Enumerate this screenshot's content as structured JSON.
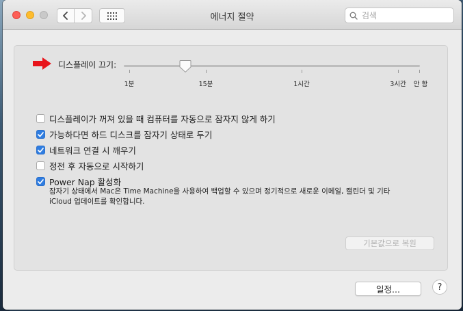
{
  "window": {
    "title": "에너지 절약"
  },
  "search": {
    "placeholder": "검색"
  },
  "slider": {
    "label": "디스플레이 끄기:",
    "value": "15분",
    "ticks": [
      "1분",
      "15분",
      "1시간",
      "3시간",
      "안 함"
    ]
  },
  "options": [
    {
      "label": "디스플레이가 꺼져 있을 때 컴퓨터를 자동으로 잠자지 않게 하기",
      "checked": false
    },
    {
      "label": "가능하다면 하드 디스크를 잠자기 상태로 두기",
      "checked": true
    },
    {
      "label": "네트워크 연결 시 깨우기",
      "checked": true
    },
    {
      "label": "정전 후 자동으로 시작하기",
      "checked": false
    },
    {
      "label": "Power Nap 활성화",
      "checked": true
    }
  ],
  "power_nap": {
    "description_line1": "잠자기 상태에서 Mac은 Time Machine을 사용하여 백업할 수 있으며 정기적으로 새로운 이메일, 캘린더 및 기타",
    "description_line2": "iCloud 업데이트를 확인합니다."
  },
  "buttons": {
    "restore_defaults": "기본값으로 복원",
    "schedule": "일정...",
    "help": "?"
  },
  "colors": {
    "accent": "#2f7de1",
    "arrow": "#e8141b"
  },
  "icons": {
    "back": "chevron-left-icon",
    "forward": "chevron-right-icon",
    "grid": "grid-icon",
    "search": "search-icon"
  }
}
